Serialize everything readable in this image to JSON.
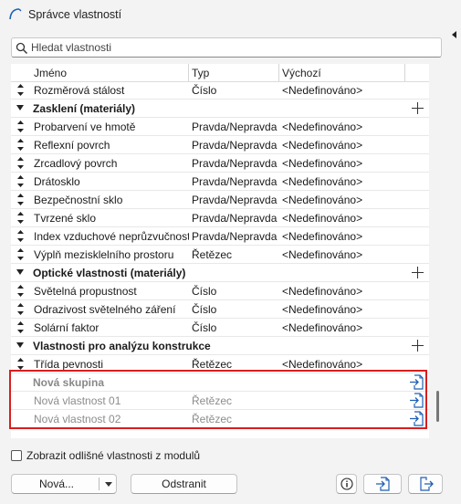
{
  "window": {
    "title": "Správce vlastností"
  },
  "search": {
    "placeholder": "Hledat vlastnosti"
  },
  "table": {
    "headers": {
      "name": "Jméno",
      "type": "Typ",
      "default": "Výchozí"
    },
    "rows": [
      {
        "kind": "prop",
        "name": "Rozměrová stálost",
        "type": "Číslo",
        "default": "<Nedefinováno>"
      },
      {
        "kind": "group",
        "name": "Zasklení (materiály)"
      },
      {
        "kind": "prop",
        "name": "Probarvení ve hmotě",
        "type": "Pravda/Nepravda",
        "default": "<Nedefinováno>"
      },
      {
        "kind": "prop",
        "name": "Reflexní povrch",
        "type": "Pravda/Nepravda",
        "default": "<Nedefinováno>"
      },
      {
        "kind": "prop",
        "name": "Zrcadlový povrch",
        "type": "Pravda/Nepravda",
        "default": "<Nedefinováno>"
      },
      {
        "kind": "prop",
        "name": "Drátosklo",
        "type": "Pravda/Nepravda",
        "default": "<Nedefinováno>"
      },
      {
        "kind": "prop",
        "name": "Bezpečnostní sklo",
        "type": "Pravda/Nepravda",
        "default": "<Nedefinováno>"
      },
      {
        "kind": "prop",
        "name": "Tvrzené sklo",
        "type": "Pravda/Nepravda",
        "default": "<Nedefinováno>"
      },
      {
        "kind": "prop",
        "name": "Index vzduchové neprůzvučnosti",
        "type": "Pravda/Nepravda",
        "default": "<Nedefinováno>"
      },
      {
        "kind": "prop",
        "name": "Výplň mezisklelního prostoru",
        "type": "Řetězec",
        "default": "<Nedefinováno>"
      },
      {
        "kind": "group",
        "name": "Optické vlastnosti (materiály)"
      },
      {
        "kind": "prop",
        "name": "Světelná propustnost",
        "type": "Číslo",
        "default": "<Nedefinováno>"
      },
      {
        "kind": "prop",
        "name": "Odrazivost světelného záření",
        "type": "Číslo",
        "default": "<Nedefinováno>"
      },
      {
        "kind": "prop",
        "name": "Solární faktor",
        "type": "Číslo",
        "default": "<Nedefinováno>"
      },
      {
        "kind": "group",
        "name": "Vlastnosti pro analýzu konstrukce"
      },
      {
        "kind": "prop",
        "name": "Třída pevnosti",
        "type": "Řetězec",
        "default": "<Nedefinováno>"
      },
      {
        "kind": "module-group",
        "name": "Nová skupina"
      },
      {
        "kind": "module-prop",
        "name": "Nová vlastnost 01",
        "type": "Řetězec",
        "default": ""
      },
      {
        "kind": "module-prop",
        "name": "Nová vlastnost 02",
        "type": "Řetězec",
        "default": ""
      }
    ]
  },
  "options": {
    "show_module_props_label": "Zobrazit odlišné vlastnosti z modulů",
    "show_module_props_checked": false
  },
  "buttons": {
    "new_label": "Nová...",
    "remove_label": "Odstranit"
  },
  "colors": {
    "highlight": "#d81e1e",
    "dim_text": "#8c8c8c",
    "icon_blue": "#1f5fb5"
  }
}
